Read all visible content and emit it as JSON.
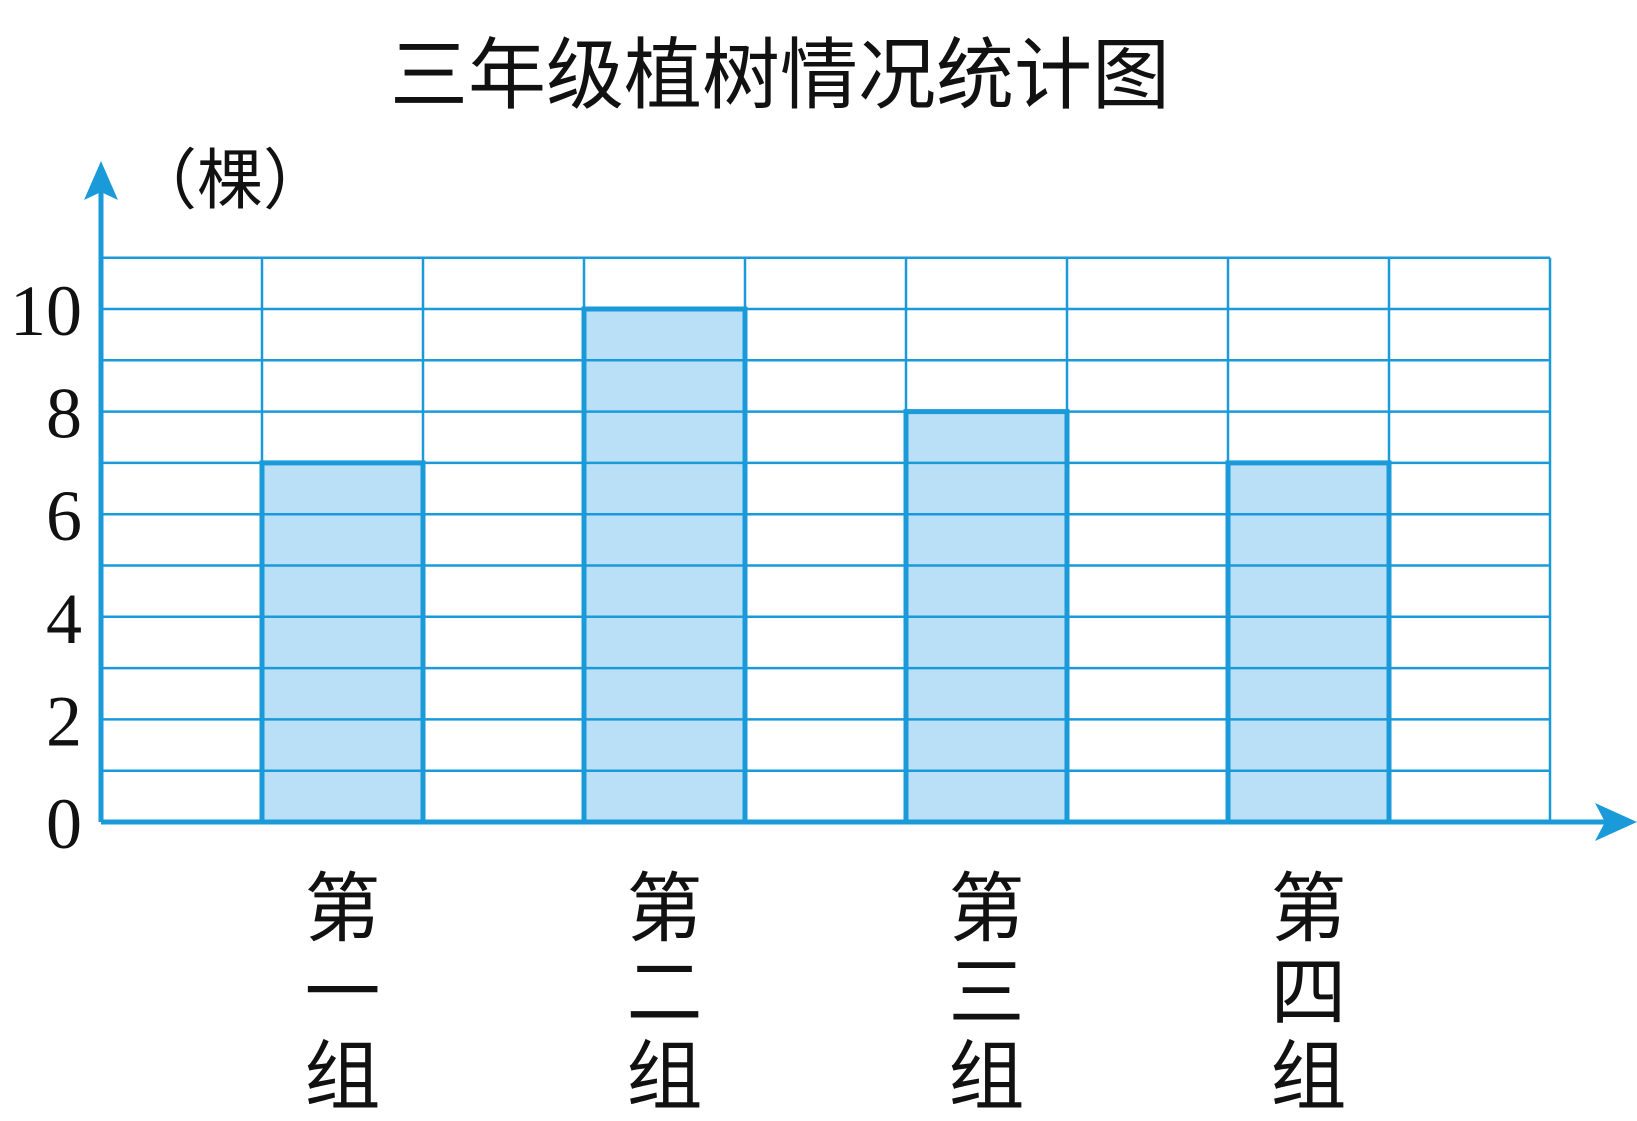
{
  "chart_data": {
    "type": "bar",
    "title": "三年级植树情况统计图",
    "ylabel": "（棵）",
    "xlabel": "",
    "categories": [
      "第一组",
      "第二组",
      "第三组",
      "第四组"
    ],
    "values": [
      7,
      10,
      8,
      7
    ],
    "ylim": [
      0,
      11
    ],
    "yticks": [
      0,
      2,
      4,
      6,
      8,
      10
    ],
    "grid": true,
    "colors": {
      "axis": "#1a9ad9",
      "grid": "#1a9ad9",
      "bar_fill": "#b9e0f6",
      "bar_stroke": "#1a9ad9"
    }
  }
}
